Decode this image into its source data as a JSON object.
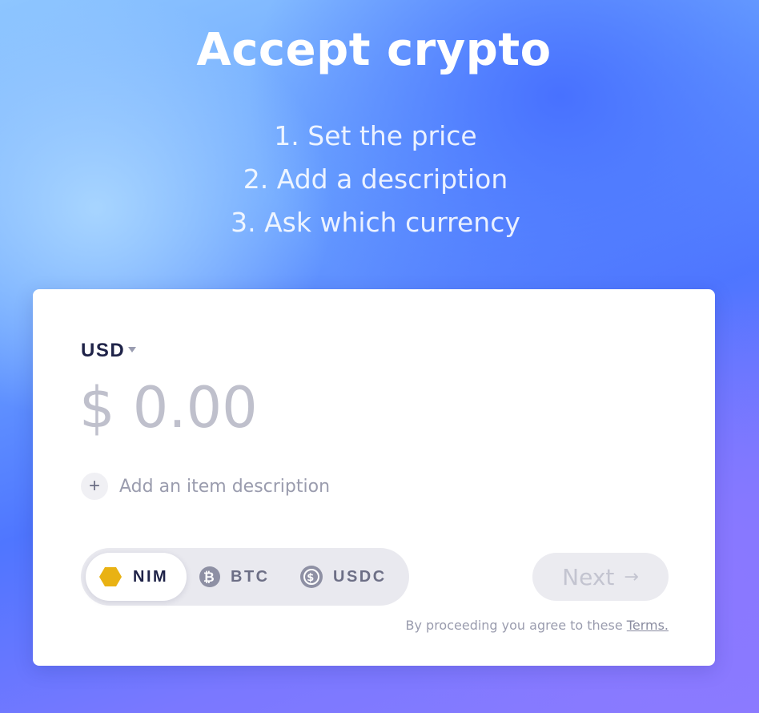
{
  "hero": {
    "title": "Accept crypto",
    "steps": [
      "1. Set the price",
      "2. Add a description",
      "3. Ask which currency"
    ]
  },
  "form": {
    "currency": "USD",
    "amount": "$ 0.00",
    "add_description_label": "Add an item description",
    "coins": [
      {
        "label": "NIM",
        "icon": "nim-hexagon-icon",
        "color": "#e9b213",
        "selected": true
      },
      {
        "label": "BTC",
        "icon": "bitcoin-icon",
        "color": "#8e90a4",
        "selected": false
      },
      {
        "label": "USDC",
        "icon": "usdc-icon",
        "color": "#8e90a4",
        "selected": false
      }
    ],
    "next_label": "Next",
    "terms_prefix": "By proceeding you agree to these",
    "terms_link": "Terms."
  },
  "colors": {
    "accent": "#4f76ff",
    "text_dark": "#1f2348",
    "nim_gold": "#e9b213"
  }
}
